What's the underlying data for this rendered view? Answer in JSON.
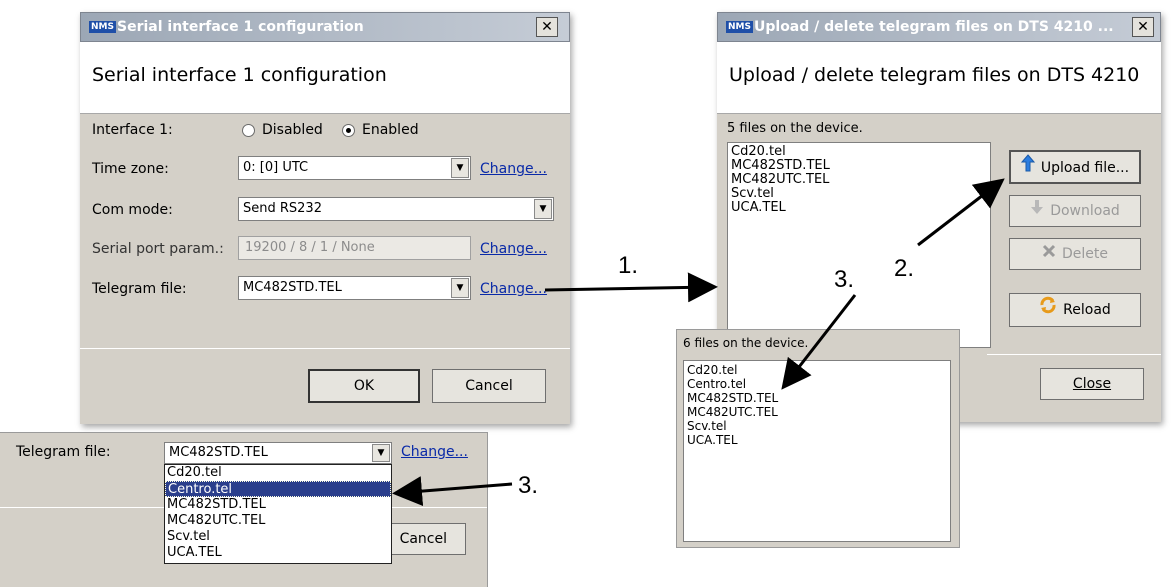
{
  "serial_dialog": {
    "logo": "NMS",
    "title": "Serial interface 1 configuration",
    "header": "Serial interface 1 configuration",
    "interface_label": "Interface 1:",
    "radio_disabled": "Disabled",
    "radio_enabled": "Enabled",
    "timezone_label": "Time zone:",
    "timezone_value": "0: [0] UTC",
    "change_label": "Change...",
    "commode_label": "Com mode:",
    "commode_value": "Send RS232",
    "serialparam_label": "Serial port param.:",
    "serialparam_value": "19200 / 8 / 1 / None",
    "telegram_label": "Telegram file:",
    "telegram_value": "MC482STD.TEL",
    "ok": "OK",
    "cancel": "Cancel",
    "close_glyph": "✕"
  },
  "upload_dialog": {
    "logo": "NMS",
    "title": "Upload / delete telegram files on DTS 4210 ...",
    "header": "Upload / delete telegram files on DTS 4210",
    "count": "5 files on the device.",
    "files": [
      "Cd20.tel",
      "MC482STD.TEL",
      "MC482UTC.TEL",
      "Scv.tel",
      "UCA.TEL"
    ],
    "upload": "Upload file...",
    "download": "Download",
    "delete": "Delete",
    "reload": "Reload",
    "close": "Close",
    "close_glyph": "✕"
  },
  "after_upload": {
    "count": "6 files on the device.",
    "files": [
      "Cd20.tel",
      "Centro.tel",
      "MC482STD.TEL",
      "MC482UTC.TEL",
      "Scv.tel",
      "UCA.TEL"
    ]
  },
  "telegram_dropdown": {
    "label": "Telegram file:",
    "value": "MC482STD.TEL",
    "change": "Change...",
    "cancel_partial": "Cancel",
    "options": [
      "Cd20.tel",
      "Centro.tel",
      "MC482STD.TEL",
      "MC482UTC.TEL",
      "Scv.tel",
      "UCA.TEL"
    ],
    "selected": "Centro.tel"
  },
  "annotations": {
    "step1": "1.",
    "step2": "2.",
    "step3a": "3.",
    "step3b": "3."
  },
  "colors": {
    "link": "#0a2aa8",
    "selection": "#2a3e8c"
  }
}
